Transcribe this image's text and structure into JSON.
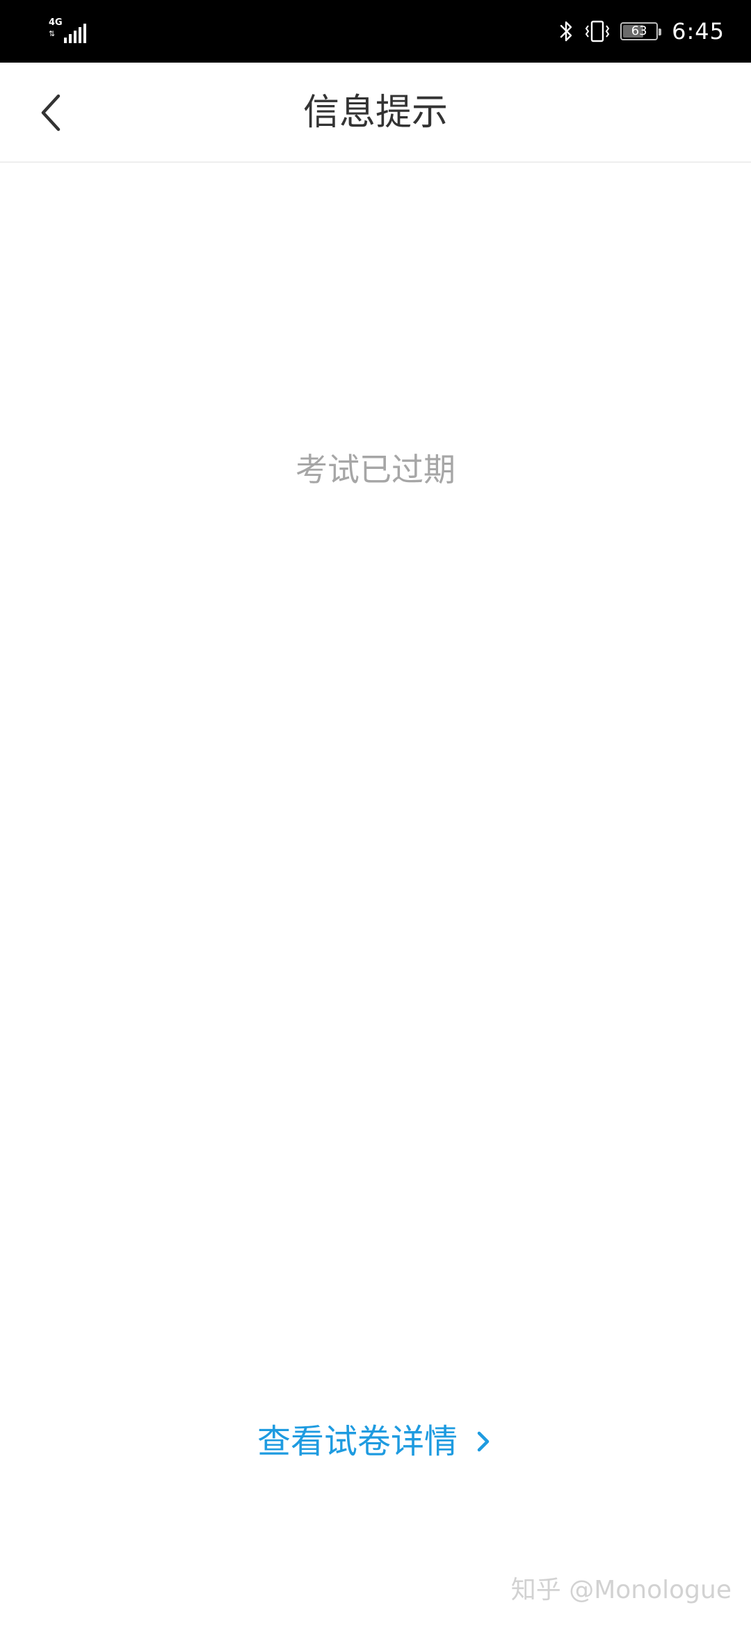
{
  "status_bar": {
    "network": "4G",
    "battery_percent": 63,
    "battery_label": "63",
    "time": "6:45",
    "icons": [
      "signal-icon",
      "bluetooth-icon",
      "vibrate-icon",
      "battery-icon"
    ]
  },
  "header": {
    "title": "信息提示",
    "back_icon": "back-arrow-icon"
  },
  "main": {
    "message": "考试已过期",
    "detail_link": {
      "label": "查看试卷详情",
      "icon": "chevron-right-icon"
    }
  },
  "watermark": {
    "text": "知乎 @Monologue"
  },
  "colors": {
    "status_bar_bg": "#000000",
    "title_text": "#333333",
    "message_text": "#a6a6a6",
    "link_blue": "#1e9be0",
    "divider": "#eeeeee"
  }
}
